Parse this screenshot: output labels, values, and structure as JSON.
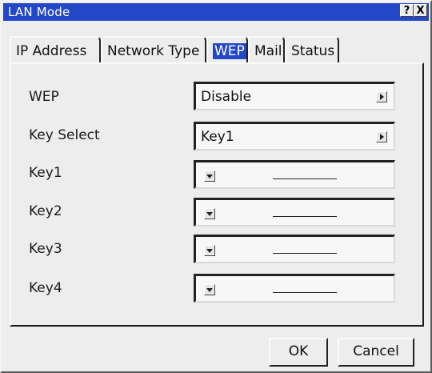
{
  "window": {
    "title": "LAN Mode",
    "help_label": "?",
    "close_label": "X"
  },
  "tabs": [
    {
      "label": "IP Address",
      "active": false
    },
    {
      "label": "Network Type",
      "active": false
    },
    {
      "label": "WEP",
      "active": true
    },
    {
      "label": "Mail",
      "active": false
    },
    {
      "label": "Status",
      "active": false
    }
  ],
  "form": {
    "wep": {
      "label": "WEP",
      "value": "Disable",
      "icon": "arrow-right-icon"
    },
    "key_select": {
      "label": "Key Select",
      "value": "Key1",
      "icon": "arrow-right-icon"
    },
    "keys": [
      {
        "label": "Key1",
        "value": "",
        "icon": "arrow-down-icon"
      },
      {
        "label": "Key2",
        "value": "",
        "icon": "arrow-down-icon"
      },
      {
        "label": "Key3",
        "value": "",
        "icon": "arrow-down-icon"
      },
      {
        "label": "Key4",
        "value": "",
        "icon": "arrow-down-icon"
      }
    ]
  },
  "buttons": {
    "ok": "OK",
    "cancel": "Cancel"
  },
  "colors": {
    "titlebar": "#2248c8",
    "active_tab_highlight": "#2248c8",
    "surface": "#ededed"
  }
}
